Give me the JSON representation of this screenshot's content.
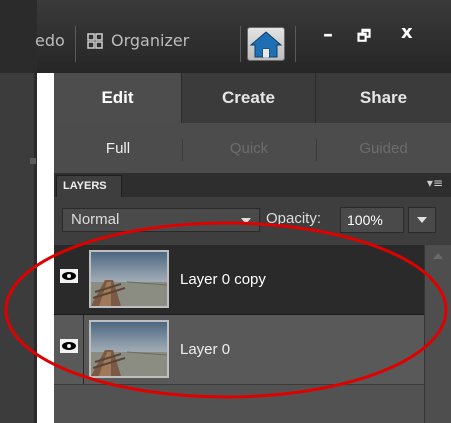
{
  "titlebar": {
    "partial_text": "edo",
    "organizer_label": "Organizer",
    "minimize_glyph": "–",
    "restore_glyph": "🗗",
    "close_glyph": "x"
  },
  "mode_tabs": [
    {
      "label": "Edit",
      "active": true
    },
    {
      "label": "Create",
      "active": false
    },
    {
      "label": "Share",
      "active": false
    }
  ],
  "sub_tabs": [
    {
      "label": "Full",
      "active": true
    },
    {
      "label": "Quick",
      "active": false
    },
    {
      "label": "Guided",
      "active": false
    }
  ],
  "layers_panel": {
    "tab_label": "LAYERS",
    "menu_glyph": "▾≡",
    "blend_mode": "Normal",
    "opacity_label": "Opacity:",
    "opacity_value": "100%",
    "layers": [
      {
        "name": "Layer 0 copy",
        "selected": true,
        "visible": true
      },
      {
        "name": "Layer 0",
        "selected": false,
        "visible": true
      }
    ]
  },
  "colors": {
    "annotation": "#e00000",
    "home_icon": "#1f6fb5"
  },
  "icons": [
    "organizer-icon",
    "home-icon",
    "eye-icon",
    "panel-menu-icon",
    "dropdown-arrow-icon"
  ]
}
